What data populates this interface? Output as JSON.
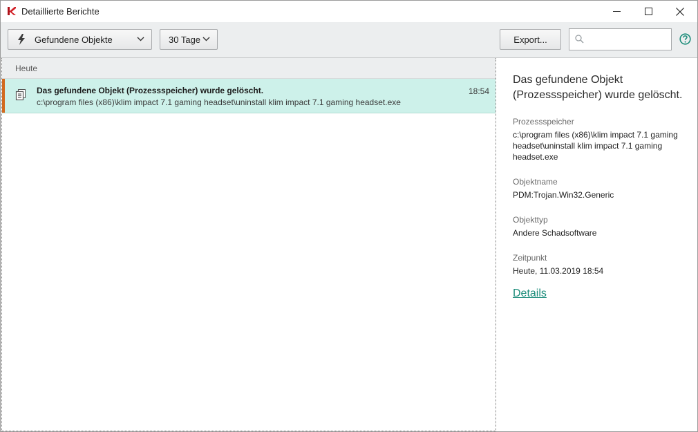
{
  "window": {
    "title": "Detaillierte Berichte",
    "icons": {
      "app": "kaspersky-k-logo",
      "minimize": "minimize-icon",
      "maximize": "maximize-icon",
      "close": "close-icon"
    }
  },
  "toolbar": {
    "filter_label": "Gefundene Objekte",
    "filter_icon": "lightning-icon",
    "period_label": "30 Tage",
    "export_label": "Export...",
    "search_placeholder": "",
    "search_value": "",
    "help_icon": "help-icon"
  },
  "list": {
    "group_label": "Heute",
    "items": [
      {
        "title": "Das gefundene Objekt (Prozessspeicher) wurde gelöscht.",
        "path": "c:\\program files (x86)\\klim impact 7.1 gaming headset\\uninstall klim impact 7.1 gaming headset.exe",
        "time": "18:54",
        "icon": "process-memory-icon"
      }
    ]
  },
  "details": {
    "title": "Das gefundene Objekt (Prozessspeicher) wurde gelöscht.",
    "fields": [
      {
        "label": "Prozessspeicher",
        "value": "c:\\program files (x86)\\klim impact 7.1 gaming headset\\uninstall klim impact 7.1 gaming headset.exe"
      },
      {
        "label": "Objektname",
        "value": "PDM:Trojan.Win32.Generic"
      },
      {
        "label": "Objekttyp",
        "value": "Andere Schadsoftware"
      },
      {
        "label": "Zeitpunkt",
        "value": "Heute, 11.03.2019 18:54"
      }
    ],
    "link_label": "Details"
  },
  "colors": {
    "accent": "#1b8c7a",
    "selected_row": "#cdf1ea",
    "row_marker": "#d26a1f",
    "toolbar_bg": "#eceeef"
  }
}
